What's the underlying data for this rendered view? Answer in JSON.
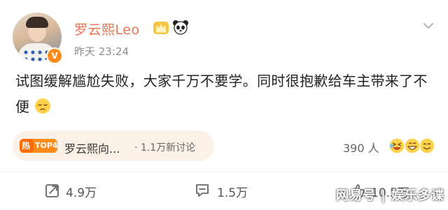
{
  "post": {
    "username": "罗云熙Leo",
    "time": "昨天 23:24",
    "verified_badge": "V",
    "text": "试图缓解尴尬失败，大家千万不要学。同时很抱歉给车主带来了不便",
    "text_emoji": "pensive-emoji"
  },
  "topic": {
    "hot_label": "热",
    "rank_label": "TOP4",
    "name": "罗云熙向...",
    "count": "· 1.1万新讨论"
  },
  "reactions": {
    "count": "390 人",
    "emojis": [
      "laugh-emoji",
      "grin-emoji",
      "smile-emoji"
    ]
  },
  "actions": {
    "repost_count": "4.9万",
    "comment_count": "1.5万",
    "like_count": "10.5万"
  },
  "watermark": "网易号 | 娱乐多谍",
  "colors": {
    "username": "#eb7350",
    "topic_bg": "#fbf1e6",
    "hot_orange": "#ff8c1a"
  }
}
